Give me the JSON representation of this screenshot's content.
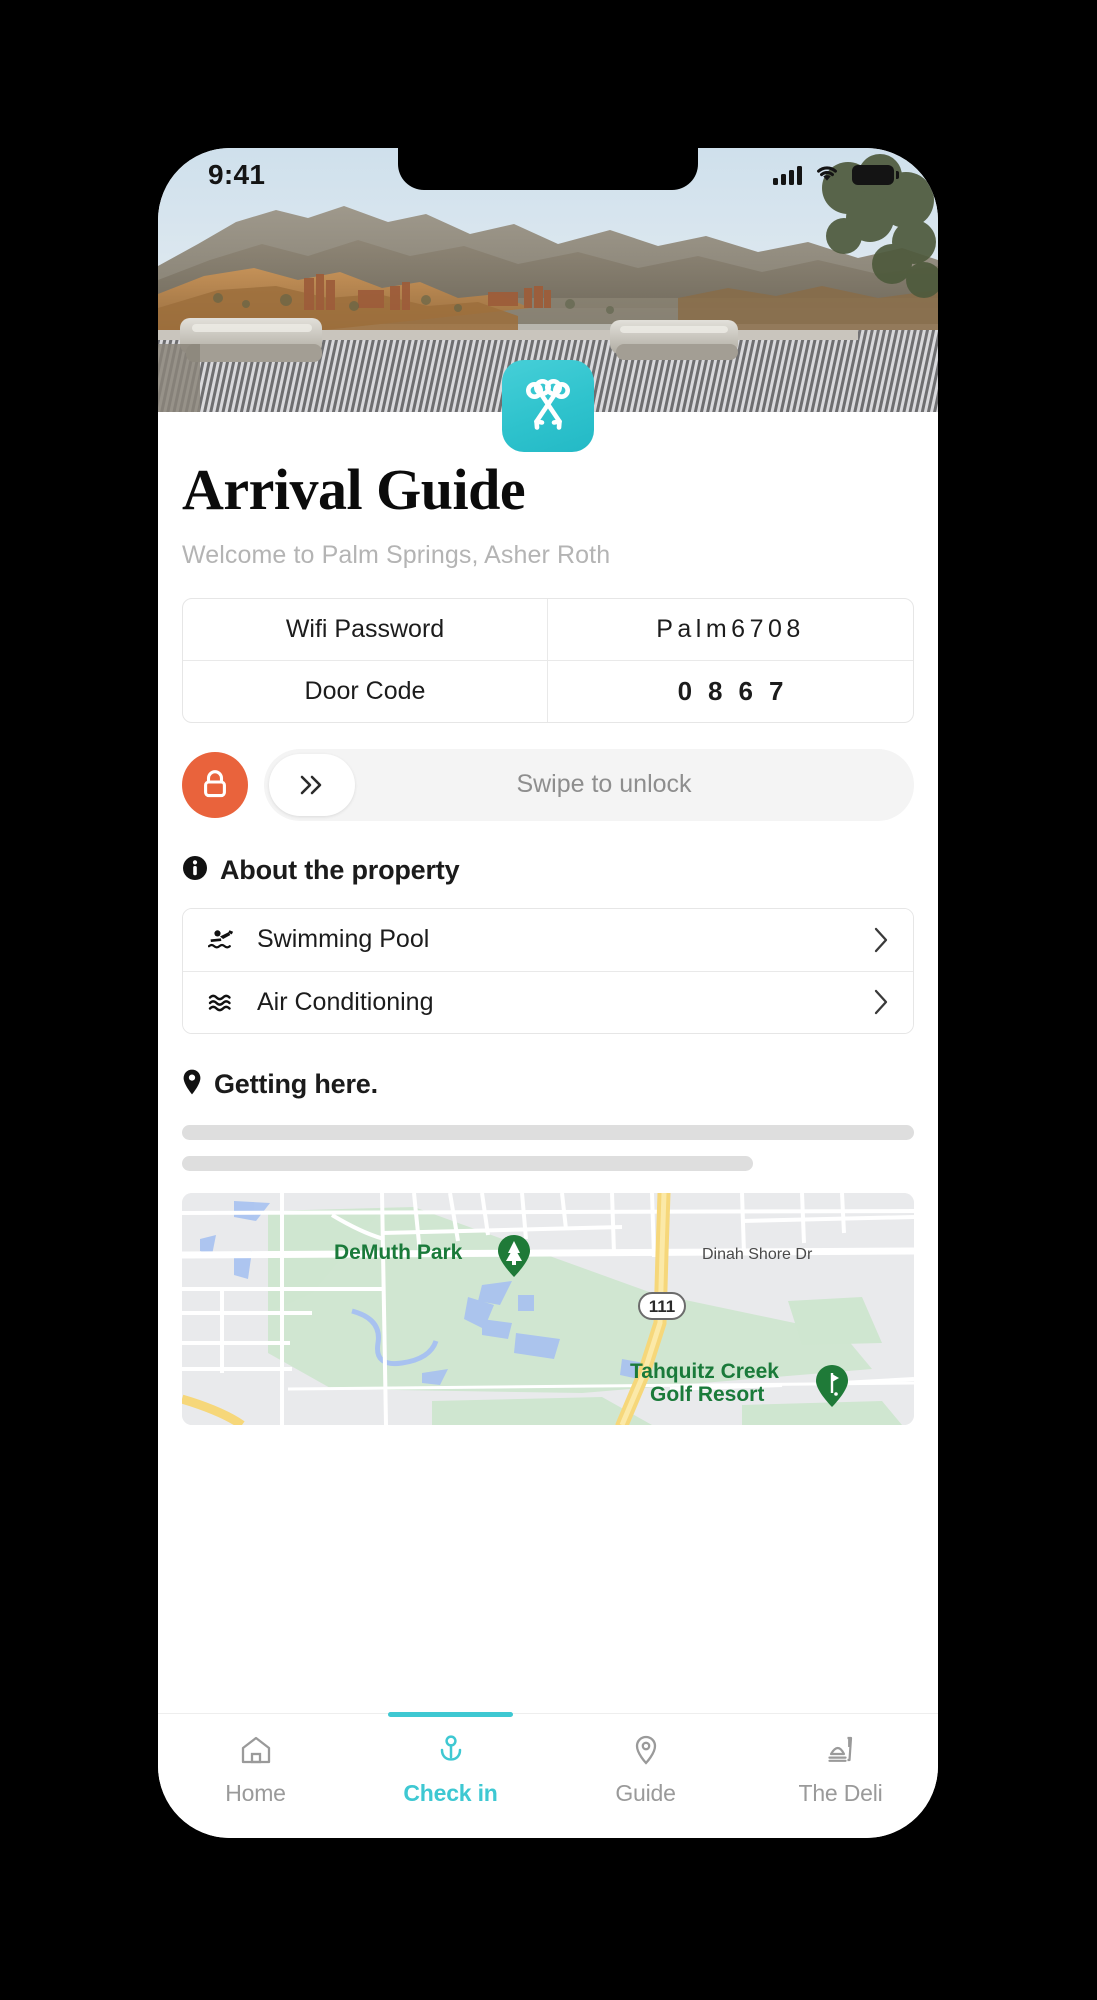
{
  "status_bar": {
    "time": "9:41",
    "icons": [
      "cellular-signal-icon",
      "wifi-icon",
      "battery-icon"
    ]
  },
  "colors": {
    "brand_cyan": "#3ec8d2",
    "lock_orange": "#e9633c",
    "text_dark": "#1b1b1b",
    "text_muted": "#9a9a9a",
    "skeleton_gray": "#dedede"
  },
  "app_logo": {
    "icon": "crossed-keys-icon",
    "background": "#2fc3cd"
  },
  "hero": {
    "alt": "Folded towels on striped sun loungers overlooking desert mountains at sunset"
  },
  "header": {
    "title": "Arrival Guide",
    "subtitle": "Welcome to Palm Springs, Asher Roth"
  },
  "info_table": {
    "rows": [
      {
        "label": "Wifi Password",
        "value": "Palm6708"
      },
      {
        "label": "Door Code",
        "value": "0867"
      }
    ]
  },
  "unlock": {
    "lock_icon": "lock-closed-icon",
    "chevron_icon": "double-chevron-right-icon",
    "label": "Swipe to unlock"
  },
  "about_section": {
    "icon": "info-circle-icon",
    "title": "About the property",
    "items": [
      {
        "icon": "swimmer-icon",
        "label": "Swimming Pool",
        "chevron": "chevron-right-icon"
      },
      {
        "icon": "waves-icon",
        "label": "Air Conditioning",
        "chevron": "chevron-right-icon"
      }
    ]
  },
  "getting_here": {
    "icon": "map-pin-icon",
    "title": "Getting here.",
    "placeholder_lines": 2
  },
  "map": {
    "labels": [
      {
        "text": "DeMuth Park",
        "kind": "park"
      },
      {
        "text": "Dinah Shore Dr",
        "kind": "street"
      },
      {
        "text": "111",
        "kind": "highway-shield"
      },
      {
        "text": "Tahquitz Creek",
        "kind": "poi"
      },
      {
        "text": "Golf Resort",
        "kind": "poi"
      }
    ],
    "markers": [
      {
        "icon": "park-tree-marker",
        "label": "DeMuth Park"
      },
      {
        "icon": "golf-marker",
        "label": "Tahquitz Creek Golf Resort"
      }
    ]
  },
  "tab_bar": {
    "tabs": [
      {
        "label": "Home",
        "icon": "home-icon",
        "active": false
      },
      {
        "label": "Check in",
        "icon": "check-in-pin-icon",
        "active": true
      },
      {
        "label": "Guide",
        "icon": "location-pin-icon",
        "active": false
      },
      {
        "label": "The Deli",
        "icon": "food-tray-icon",
        "active": false
      }
    ]
  }
}
